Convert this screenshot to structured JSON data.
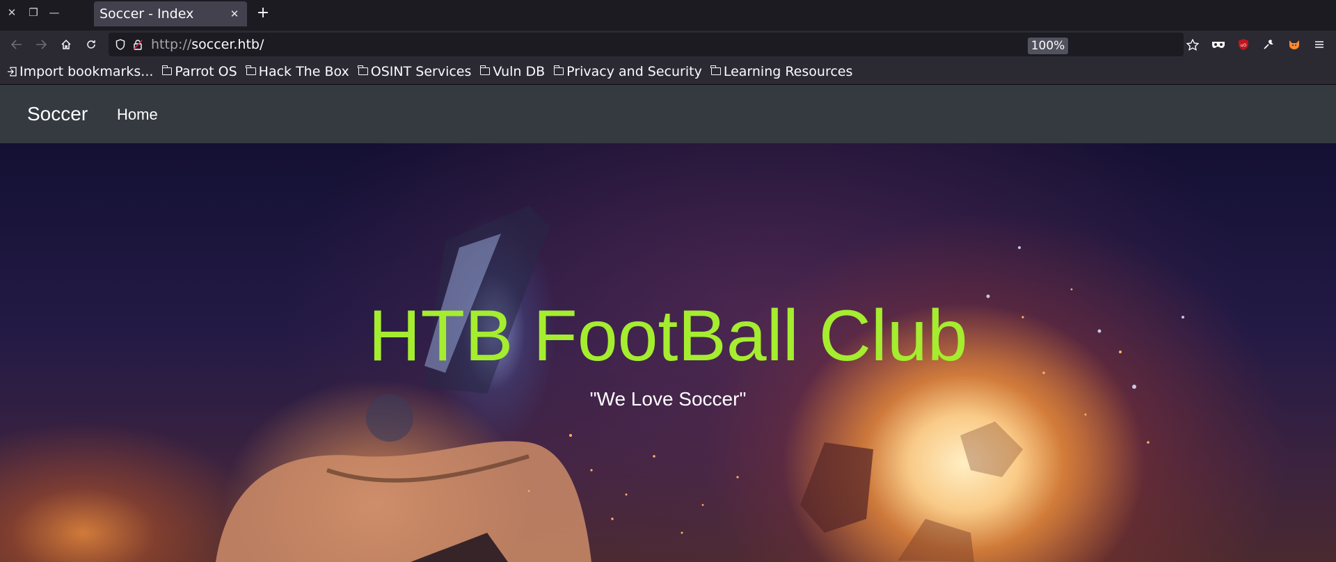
{
  "window": {
    "close_glyph": "✕",
    "restore_glyph": "❐",
    "minimize_glyph": "—"
  },
  "tab": {
    "title": "Soccer - Index",
    "close_glyph": "✕",
    "new_tab_glyph": "+"
  },
  "nav": {
    "back_icon": "arrow-left-icon",
    "forward_icon": "arrow-right-icon",
    "home_icon": "home-icon",
    "reload_icon": "reload-icon",
    "url_protocol": "http://",
    "url_host": "soccer.htb/",
    "zoom": "100%"
  },
  "bookmarks": [
    {
      "label": "Import bookmarks...",
      "icon": "import-icon"
    },
    {
      "label": "Parrot OS",
      "icon": "folder-icon"
    },
    {
      "label": "Hack The Box",
      "icon": "folder-icon"
    },
    {
      "label": "OSINT Services",
      "icon": "folder-icon"
    },
    {
      "label": "Vuln DB",
      "icon": "folder-icon"
    },
    {
      "label": "Privacy and Security",
      "icon": "folder-icon"
    },
    {
      "label": "Learning Resources",
      "icon": "folder-icon"
    }
  ],
  "site": {
    "brand": "Soccer",
    "nav_home": "Home",
    "hero_title": "HTB FootBall Club",
    "hero_subtitle": "\"We Love Soccer\""
  },
  "colors": {
    "hero_title": "#a5ed2f",
    "site_nav_bg": "#343a40",
    "browser_bg": "#1c1b22"
  }
}
